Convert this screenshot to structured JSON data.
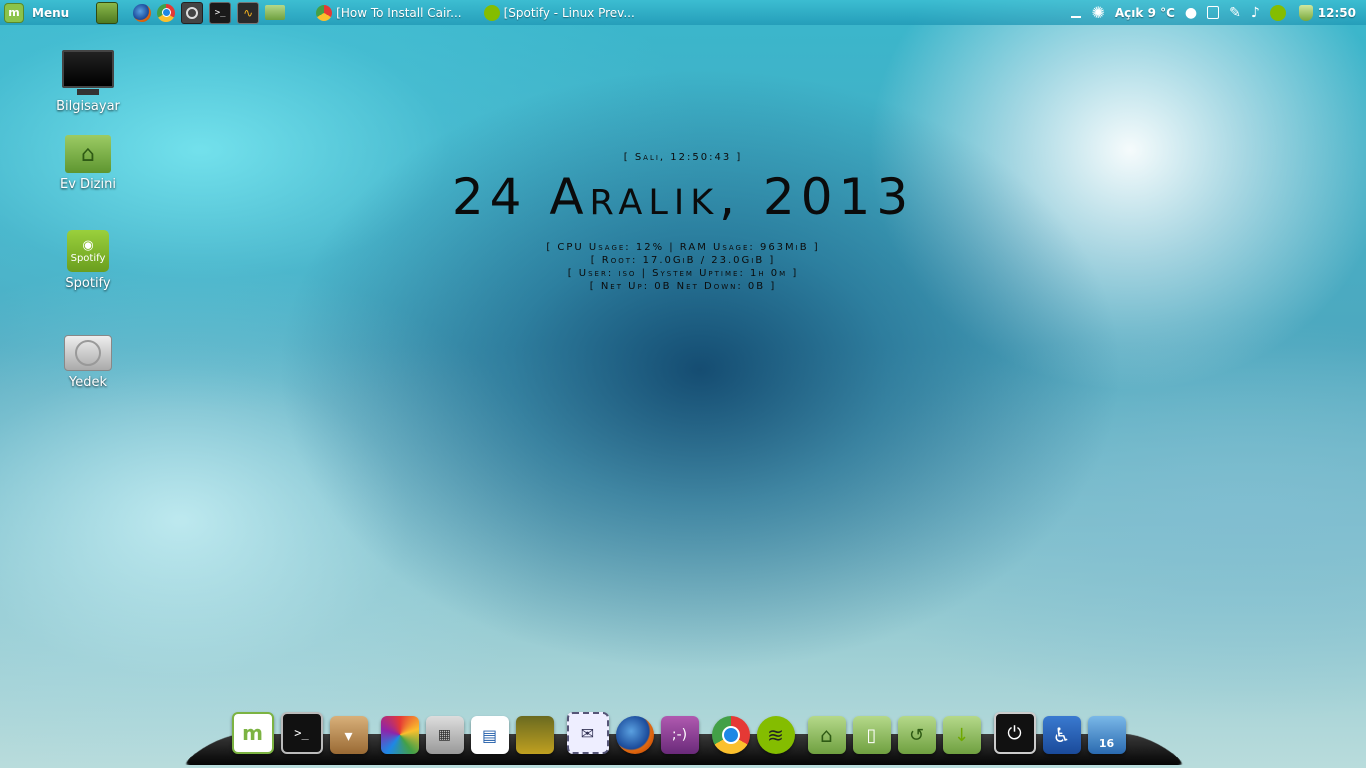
{
  "panel": {
    "menu_label": "Menu",
    "launchers": [
      "show-desktop",
      "firefox",
      "chrome",
      "screenshot",
      "terminal",
      "system-monitor",
      "files"
    ],
    "tasks": [
      {
        "label": "[How To Install Cair...",
        "icon": "chrome-icon"
      },
      {
        "label": "[Spotify - Linux Prev...",
        "icon": "spotify-icon"
      }
    ],
    "weather": "Açık 9 °C",
    "clock": "12:50"
  },
  "desktop_icons": [
    {
      "label": "Bilgisayar",
      "icon": "computer-icon"
    },
    {
      "label": "Ev Dizini",
      "icon": "home-folder-icon"
    },
    {
      "label": "Spotify",
      "icon": "spotify-icon"
    },
    {
      "label": "Yedek",
      "icon": "drive-icon"
    }
  ],
  "conky": {
    "time_line": "[ Salı, 12:50:43 ]",
    "date_line": "24 Aralık, 2013",
    "cpu_ram": "[ CPU Usage: 12% | RAM Usage: 963MiB ]",
    "root": "[ Root: 17.0GiB / 23.0GiB ]",
    "user_uptime": "[ User: iso | System Uptime: 1h 0m ]",
    "net": "[ Net Up: 0B   Net Down: 0B   ]"
  },
  "dock": {
    "trash_count": "16",
    "spotify_label": "Spotify"
  }
}
